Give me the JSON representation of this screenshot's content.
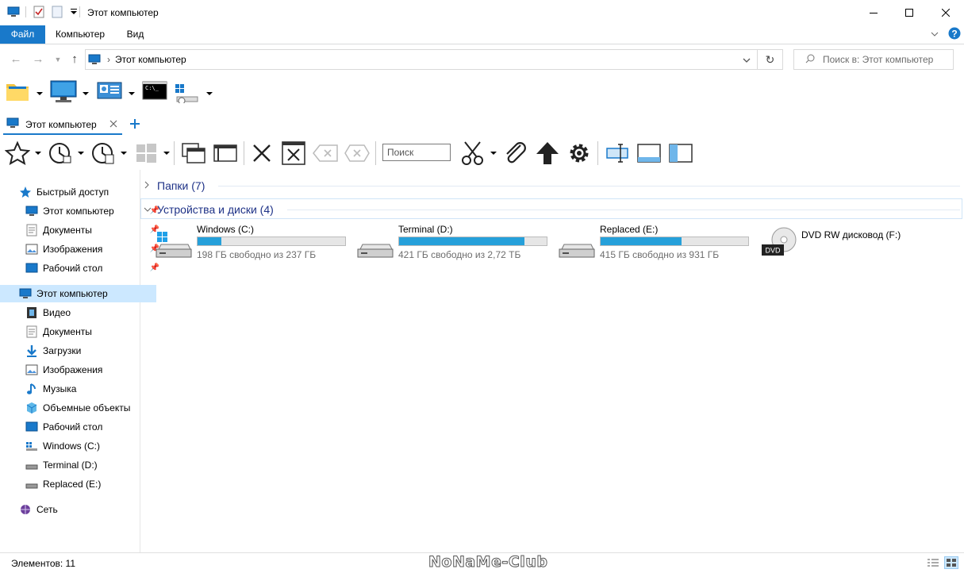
{
  "window": {
    "title": "Этот компьютер",
    "controls": {
      "minimize": "minimize-icon",
      "maximize": "maximize-icon",
      "close": "close-icon"
    }
  },
  "ribbon": {
    "tabs": [
      "Файл",
      "Компьютер",
      "Вид"
    ]
  },
  "address": {
    "path": "Этот компьютер",
    "search_placeholder": "Поиск в: Этот компьютер"
  },
  "tabs": [
    {
      "label": "Этот компьютер"
    }
  ],
  "toolbar": {
    "search_placeholder": "Поиск"
  },
  "sidebar": {
    "quick_access": {
      "label": "Быстрый доступ",
      "items": [
        {
          "label": "Этот компьютер",
          "pinned": true
        },
        {
          "label": "Документы",
          "pinned": true
        },
        {
          "label": "Изображения",
          "pinned": true
        },
        {
          "label": "Рабочий стол",
          "pinned": true
        }
      ]
    },
    "this_pc": {
      "label": "Этот компьютер",
      "items": [
        {
          "label": "Видео"
        },
        {
          "label": "Документы"
        },
        {
          "label": "Загрузки"
        },
        {
          "label": "Изображения"
        },
        {
          "label": "Музыка"
        },
        {
          "label": "Объемные объекты"
        },
        {
          "label": "Рабочий стол"
        },
        {
          "label": "Windows (C:)"
        },
        {
          "label": "Terminal (D:)"
        },
        {
          "label": "Replaced (E:)"
        }
      ]
    },
    "network": {
      "label": "Сеть"
    }
  },
  "content": {
    "folders_group": "Папки (7)",
    "devices_group": "Устройства и диски (4)",
    "drives": [
      {
        "name": "Windows (C:)",
        "free_text": "198 ГБ свободно из 237 ГБ",
        "used_fraction": 0.16
      },
      {
        "name": "Terminal (D:)",
        "free_text": "421 ГБ свободно из 2,72 ТБ",
        "used_fraction": 0.85
      },
      {
        "name": "Replaced (E:)",
        "free_text": "415 ГБ свободно из 931 ГБ",
        "used_fraction": 0.55
      },
      {
        "name": "DVD RW дисковод (F:)",
        "badge": "DVD"
      }
    ]
  },
  "status": {
    "items_count": "Элементов: 11",
    "watermark": "NoNaMe-Club"
  },
  "colors": {
    "accent": "#1979ca",
    "bar_fill": "#26a0da",
    "selection": "#cce8ff",
    "group_header": "#1e3287"
  }
}
